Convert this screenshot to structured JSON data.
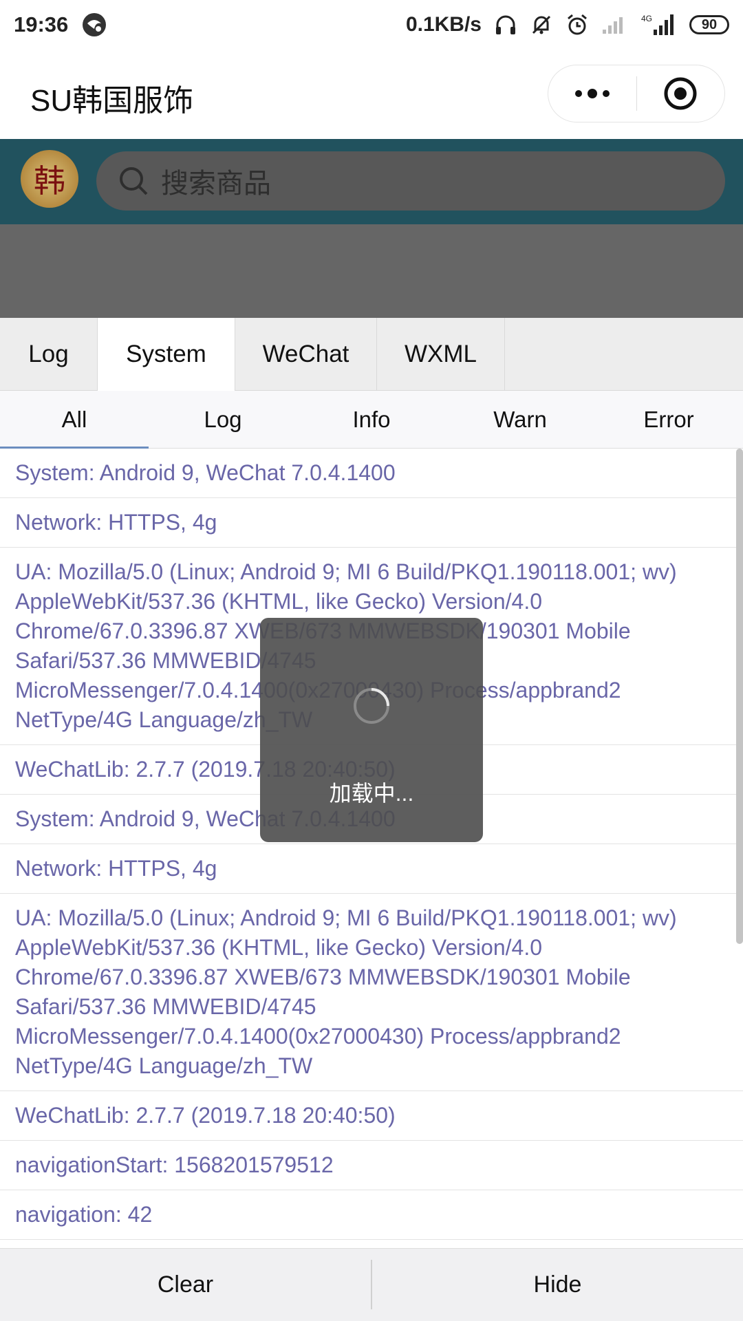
{
  "status_bar": {
    "time": "19:36",
    "network_speed": "0.1KB/s",
    "network_type": "4G",
    "battery": "90"
  },
  "title_bar": {
    "title": "SU韩国服饰"
  },
  "header": {
    "logo_char": "韩",
    "search_placeholder": "搜索商品"
  },
  "console": {
    "tabs": [
      {
        "label": "Log"
      },
      {
        "label": "System"
      },
      {
        "label": "WeChat"
      },
      {
        "label": "WXML"
      }
    ],
    "active_tab": "System",
    "filters": [
      {
        "label": "All"
      },
      {
        "label": "Log"
      },
      {
        "label": "Info"
      },
      {
        "label": "Warn"
      },
      {
        "label": "Error"
      }
    ],
    "active_filter": "All",
    "entries": [
      "System: Android 9, WeChat 7.0.4.1400",
      "Network: HTTPS, 4g",
      "UA: Mozilla/5.0 (Linux; Android 9; MI 6 Build/PKQ1.190118.001; wv) AppleWebKit/537.36 (KHTML, like Gecko) Version/4.0 Chrome/67.0.3396.87 XWEB/673 MMWEBSDK/190301 Mobile Safari/537.36 MMWEBID/4745 MicroMessenger/7.0.4.1400(0x27000430) Process/appbrand2 NetType/4G Language/zh_TW",
      "WeChatLib: 2.7.7 (2019.7.18 20:40:50)",
      "System: Android 9, WeChat 7.0.4.1400",
      "Network: HTTPS, 4g",
      "UA: Mozilla/5.0 (Linux; Android 9; MI 6 Build/PKQ1.190118.001; wv) AppleWebKit/537.36 (KHTML, like Gecko) Version/4.0 Chrome/67.0.3396.87 XWEB/673 MMWEBSDK/190301 Mobile Safari/537.36 MMWEBID/4745 MicroMessenger/7.0.4.1400(0x27000430) Process/appbrand2 NetType/4G Language/zh_TW",
      "WeChatLib: 2.7.7 (2019.7.18 20:40:50)",
      "navigationStart: 1568201579512",
      "navigation: 42"
    ],
    "bottom_buttons": {
      "clear": "Clear",
      "hide": "Hide"
    }
  },
  "toast": {
    "text": "加载中..."
  },
  "colors": {
    "log_text": "#6966a8",
    "header_band": "#21525e",
    "filter_underline": "#6c8ebf"
  }
}
